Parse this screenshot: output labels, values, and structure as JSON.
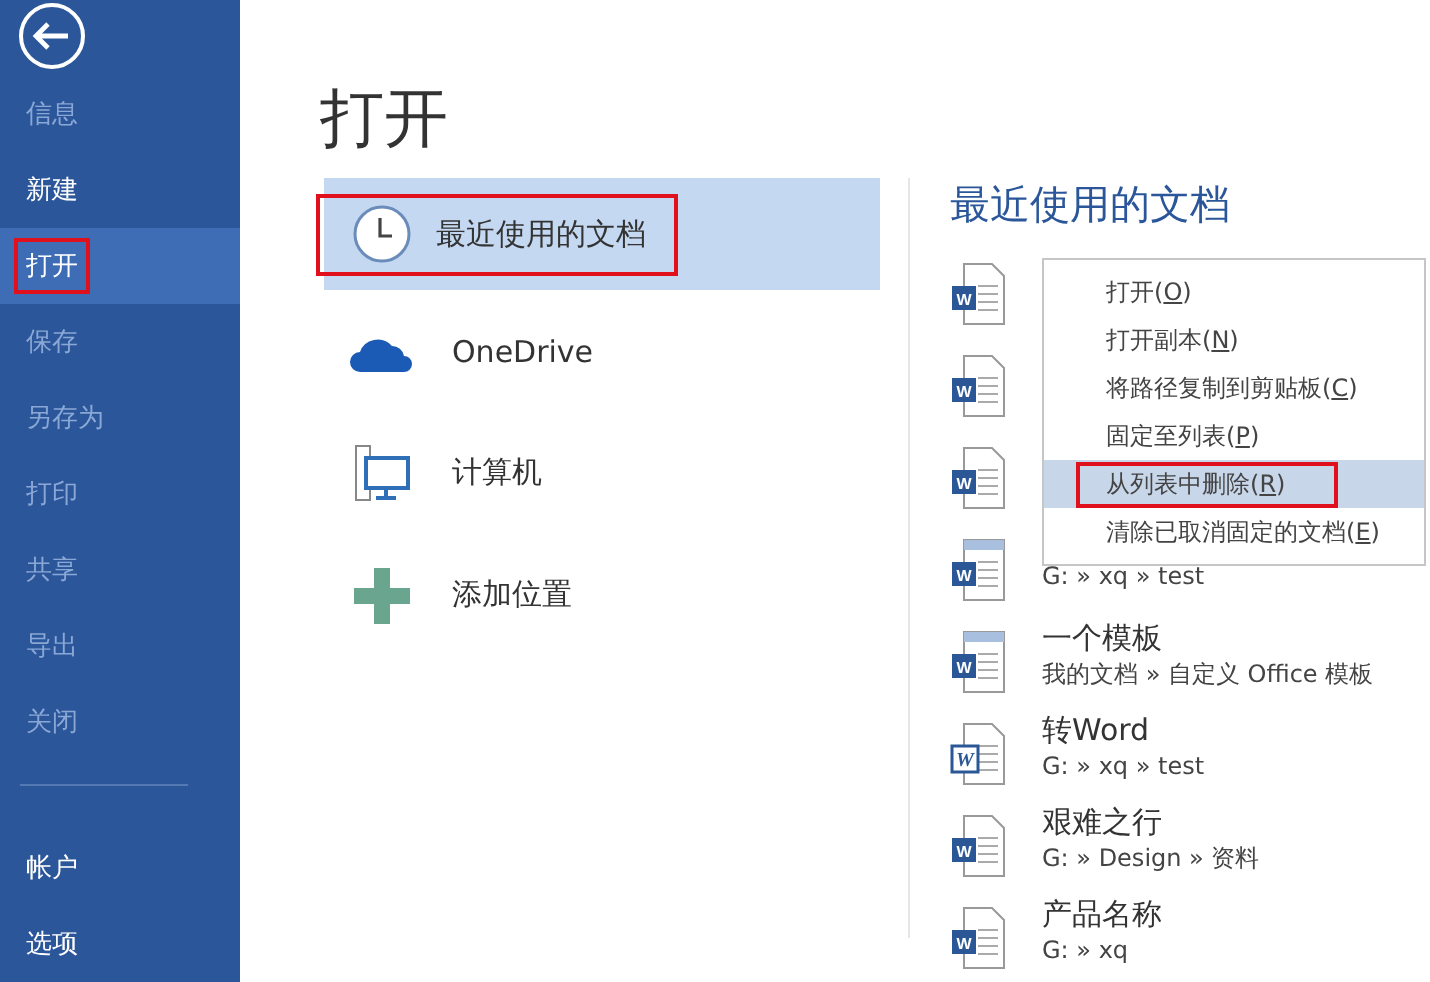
{
  "sidebar": {
    "items": [
      {
        "label": "信息",
        "disabled": true,
        "selected": false,
        "annotated": false
      },
      {
        "label": "新建",
        "disabled": false,
        "selected": false,
        "annotated": false
      },
      {
        "label": "打开",
        "disabled": false,
        "selected": true,
        "annotated": true
      },
      {
        "label": "保存",
        "disabled": true,
        "selected": false,
        "annotated": false
      },
      {
        "label": "另存为",
        "disabled": true,
        "selected": false,
        "annotated": false
      },
      {
        "label": "打印",
        "disabled": true,
        "selected": false,
        "annotated": false
      },
      {
        "label": "共享",
        "disabled": true,
        "selected": false,
        "annotated": false
      },
      {
        "label": "导出",
        "disabled": true,
        "selected": false,
        "annotated": false
      },
      {
        "label": "关闭",
        "disabled": true,
        "selected": false,
        "annotated": false
      }
    ],
    "footer_items": [
      {
        "label": "帐户",
        "disabled": false,
        "selected": false,
        "annotated": false
      },
      {
        "label": "选项",
        "disabled": false,
        "selected": false,
        "annotated": false
      }
    ]
  },
  "title": "打开",
  "places": [
    {
      "label": "最近使用的文档",
      "kind": "recent",
      "selected": true,
      "annotated": true
    },
    {
      "label": "OneDrive",
      "kind": "cloud",
      "selected": false,
      "annotated": false
    },
    {
      "label": "计算机",
      "kind": "computer",
      "selected": false,
      "annotated": false
    },
    {
      "label": "添加位置",
      "kind": "add",
      "selected": false,
      "annotated": false
    }
  ],
  "recent": {
    "title": "最近使用的文档",
    "documents": [
      {
        "kind": "doc",
        "icon_text": "W"
      },
      {
        "kind": "doc",
        "icon_text": "W"
      },
      {
        "kind": "doc",
        "icon_text": "W"
      },
      {
        "kind": "template",
        "icon_text": "W",
        "path": "G: » xq » test"
      },
      {
        "kind": "template",
        "icon_text": "W",
        "name": "一个模板",
        "path": "我的文档 » 自定义 Office 模板"
      },
      {
        "kind": "legacy",
        "icon_text": "W",
        "name": "转Word",
        "path": "G: » xq » test"
      },
      {
        "kind": "doc",
        "icon_text": "W",
        "name": "艰难之行",
        "path": "G: » Design » 资料"
      },
      {
        "kind": "doc",
        "icon_text": "W",
        "name": "产品名称",
        "path": "G: » xq"
      }
    ]
  },
  "context_menu": {
    "items": [
      {
        "label": "打开(",
        "accel": "O",
        "end": ")",
        "selected": false,
        "annotated": false
      },
      {
        "label": "打开副本(",
        "accel": "N",
        "end": ")",
        "selected": false,
        "annotated": false
      },
      {
        "label": "将路径复制到剪贴板(",
        "accel": "C",
        "end": ")",
        "selected": false,
        "annotated": false
      },
      {
        "label": "固定至列表(",
        "accel": "P",
        "end": ")",
        "selected": false,
        "annotated": false
      },
      {
        "label": "从列表中删除(",
        "accel": "R",
        "end": ")",
        "selected": true,
        "annotated": true
      },
      {
        "label": "清除已取消固定的文档(",
        "accel": "E",
        "end": ")",
        "selected": false,
        "annotated": false
      }
    ]
  }
}
